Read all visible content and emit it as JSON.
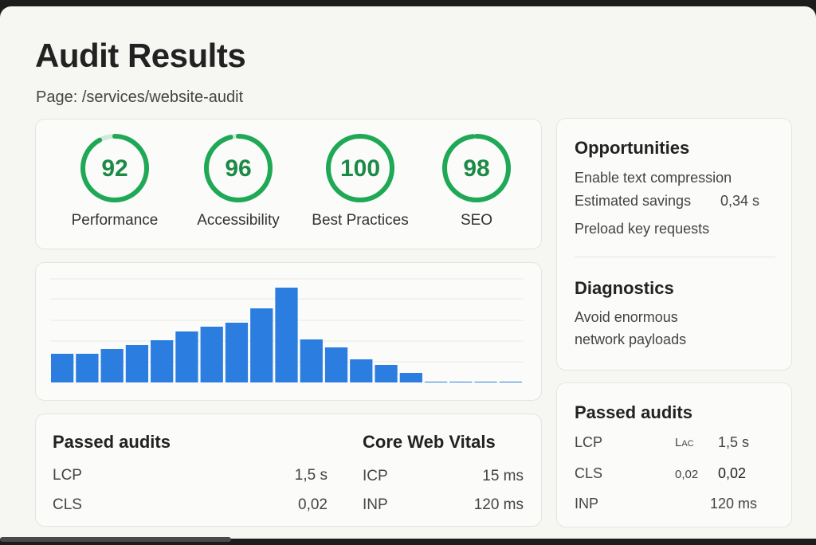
{
  "header": {
    "title": "Audit Results",
    "page_label": "Page:",
    "page_path": "/services/website-audit"
  },
  "scores": [
    {
      "value": 92,
      "label": "Performance"
    },
    {
      "value": 96,
      "label": "Accessibility"
    },
    {
      "value": 100,
      "label": "Best Practices"
    },
    {
      "value": 98,
      "label": "SEO"
    }
  ],
  "colors": {
    "score_green": "#1fa855",
    "score_track": "#cdebd6",
    "bar_blue": "#2b7de0"
  },
  "chart_data": {
    "type": "bar",
    "values": [
      36,
      36,
      42,
      47,
      53,
      64,
      70,
      75,
      93,
      119,
      54,
      44,
      29,
      22,
      12,
      1,
      1,
      1,
      1
    ],
    "ylim": [
      0,
      130
    ],
    "grid": true
  },
  "bottom_left": {
    "title": "Passed audits",
    "rows": [
      {
        "label": "LCP",
        "value": "1,5 s"
      },
      {
        "label": "CLS",
        "value": "0,02"
      }
    ]
  },
  "bottom_mid": {
    "title": "Core Web Vitals",
    "rows": [
      {
        "label": "ICP",
        "value": "15 ms"
      },
      {
        "label": "INP",
        "value": "120 ms"
      }
    ]
  },
  "opportunities": {
    "title": "Opportunities",
    "items": [
      "Enable text compression",
      "Preload key requests"
    ],
    "savings_label": "Estimated savings",
    "savings_value": "0,34 s"
  },
  "diagnostics": {
    "title": "Diagnostics",
    "line1": "Avoid enormous",
    "line2": "network payloads"
  },
  "passed_right": {
    "title": "Passed audits",
    "rows": [
      {
        "label": "LCP",
        "extra": "Lac",
        "value": "1,5 s"
      },
      {
        "label": "CLS",
        "extra": "0,02",
        "value": "0,02"
      },
      {
        "label": "INP",
        "extra": "",
        "value": "120 ms"
      }
    ]
  }
}
